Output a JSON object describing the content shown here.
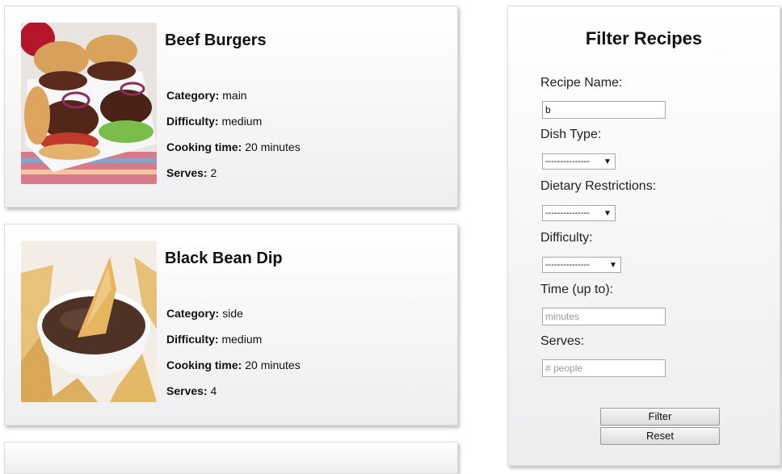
{
  "recipes": [
    {
      "title": "Beef Burgers",
      "category_label": "Category:",
      "category": "main",
      "difficulty_label": "Difficulty:",
      "difficulty": "medium",
      "time_label": "Cooking time:",
      "time": "20 minutes",
      "serves_label": "Serves:",
      "serves": "2"
    },
    {
      "title": "Black Bean Dip",
      "category_label": "Category:",
      "category": "side",
      "difficulty_label": "Difficulty:",
      "difficulty": "medium",
      "time_label": "Cooking time:",
      "time": "20 minutes",
      "serves_label": "Serves:",
      "serves": "4"
    }
  ],
  "filter": {
    "title": "Filter Recipes",
    "recipe_name_label": "Recipe Name:",
    "recipe_name_value": "b",
    "dish_type_label": "Dish Type:",
    "dish_type_value": "---------------",
    "dietary_label": "Dietary Restrictions:",
    "dietary_value": "---------------",
    "difficulty_label": "Difficulty:",
    "difficulty_value": "---------------",
    "time_label": "Time (up to):",
    "time_placeholder": "minutes",
    "serves_label": "Serves:",
    "serves_placeholder": "# people",
    "filter_button": "Filter",
    "reset_button": "Reset"
  }
}
